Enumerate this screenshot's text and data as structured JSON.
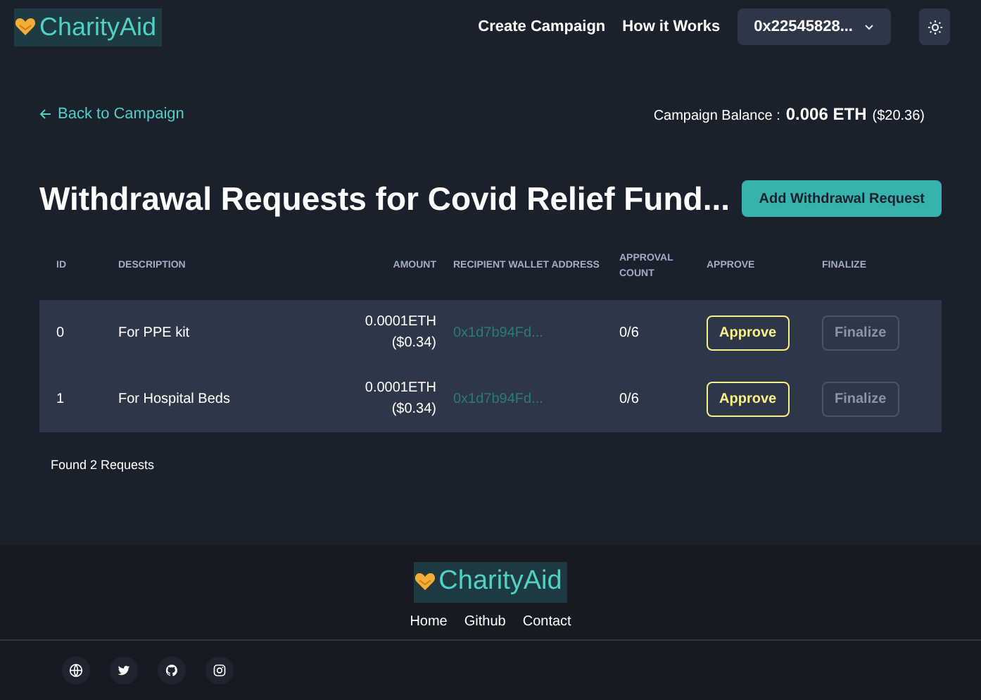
{
  "header": {
    "brand": "CharityAid",
    "nav": [
      "Create Campaign",
      "How it Works"
    ],
    "account": "0x22545828..."
  },
  "back_link": "Back to Campaign",
  "balance": {
    "label": "Campaign Balance :",
    "amount": "0.006 ETH",
    "usd": "($20.36)"
  },
  "title": "Withdrawal Requests for Covid Relief Fund...",
  "add_button": "Add Withdrawal Request",
  "table": {
    "columns": [
      "ID",
      "DESCRIPTION",
      "AMOUNT",
      "RECIPIENT WALLET ADDRESS",
      "APPROVAL COUNT",
      "APPROVE",
      "FINALIZE"
    ],
    "rows": [
      {
        "id": "0",
        "description": "For PPE kit",
        "amount": "0.0001ETH",
        "amount_usd": "($0.34)",
        "address": "0x1d7b94Fd...",
        "count": "0/6",
        "approve": {
          "label": "Approve",
          "disabled": false
        },
        "finalize": {
          "label": "Finalize",
          "disabled": true
        }
      },
      {
        "id": "1",
        "description": "For Hospital Beds",
        "amount": "0.0001ETH",
        "amount_usd": "($0.34)",
        "address": "0x1d7b94Fd...",
        "count": "0/6",
        "approve": {
          "label": "Approve",
          "disabled": false
        },
        "finalize": {
          "label": "Finalize",
          "disabled": true
        }
      }
    ]
  },
  "found": "Found 2 Requests",
  "footer": {
    "brand": "CharityAid",
    "links": [
      "Home",
      "Github",
      "Contact"
    ],
    "social": [
      {
        "kind": "globe"
      },
      {
        "kind": "twitter"
      },
      {
        "kind": "github"
      },
      {
        "kind": "instagram"
      }
    ]
  }
}
